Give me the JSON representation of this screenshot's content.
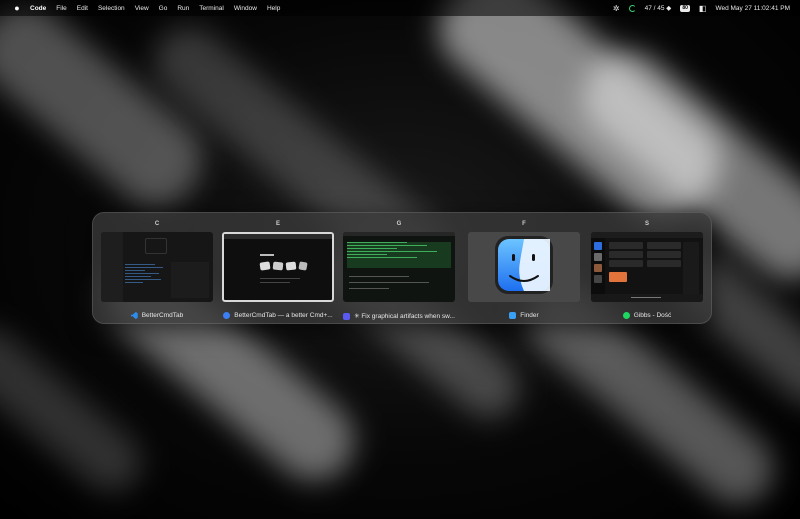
{
  "menubar": {
    "app_name": "Code",
    "menus": [
      "File",
      "Edit",
      "Selection",
      "View",
      "Go",
      "Run",
      "Terminal",
      "Window",
      "Help"
    ],
    "status_text": "47 / 45 ◆",
    "battery": "80",
    "datetime": "Wed May 27  11:02:41 PM",
    "icons": [
      "apple-icon",
      "puzzle-icon",
      "progress-ring-icon",
      "battery-icon",
      "control-center-icon"
    ]
  },
  "switcher": {
    "items": [
      {
        "key": "C",
        "label": "BetterCmdTab",
        "icon": "vscode-icon",
        "icon_color": "#2d8cf0",
        "selected": false
      },
      {
        "key": "E",
        "label": "BetterCmdTab — a better Cmd+...",
        "icon": "asterisk-icon",
        "icon_color": "#3c7ff5",
        "selected": true
      },
      {
        "key": "G",
        "label": "✳ Fix graphical artifacts when sw...",
        "icon": "terminal-icon",
        "icon_color": "#5a5af0",
        "selected": false
      },
      {
        "key": "F",
        "label": "Finder",
        "icon": "finder-icon",
        "icon_color": "#3aa0f5",
        "selected": false
      },
      {
        "key": "S",
        "label": "Gibbs - Dość",
        "icon": "spotify-icon",
        "icon_color": "#1ed760",
        "selected": false
      }
    ]
  },
  "colors": {
    "panel": "#3a3a3a",
    "selected_border": "#d8d8d8",
    "spotify_green": "#1ed760",
    "finder_blue": "#2f7ff0"
  }
}
